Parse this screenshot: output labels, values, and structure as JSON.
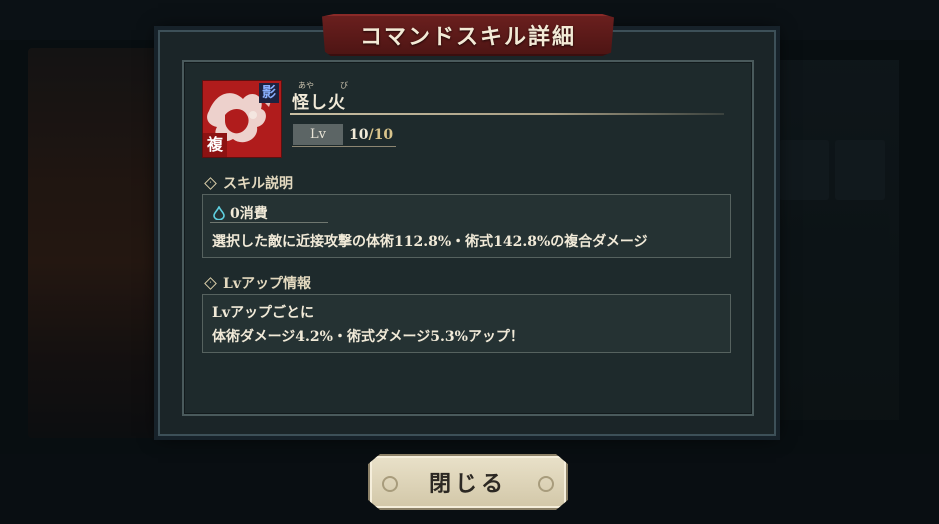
{
  "dialog": {
    "title": "コマンドスキル詳細"
  },
  "skill": {
    "name": "怪し火",
    "ruby_1": "あや",
    "ruby_2": "び",
    "icon_badge_top": "影",
    "icon_badge_bottom": "複",
    "level_label": "Lv",
    "level_current": "10",
    "level_max": "/10"
  },
  "description_section": {
    "heading": "スキル説明",
    "cost": "0消費",
    "text": "選択した敵に近接攻撃の体術112.8%・術式142.8%の複合ダメージ"
  },
  "levelup_section": {
    "heading": "Lvアップ情報",
    "line1": "Lvアップごとに",
    "line2": "体術ダメージ4.2%・術式ダメージ5.3%アップ！"
  },
  "buttons": {
    "close_label": "閉じる"
  },
  "icons": {
    "section_marker": "diamond-icon",
    "cost": "water-drop-icon"
  },
  "colors": {
    "title_banner": "#5b1a19",
    "icon_background": "#b01c1c",
    "level_max": "#d9c48c"
  }
}
